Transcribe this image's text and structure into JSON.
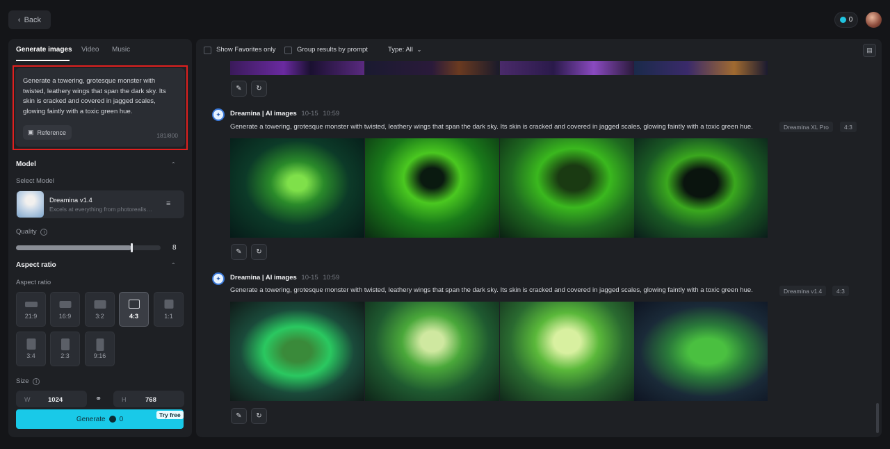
{
  "header": {
    "back_label": "Back",
    "credits": "0"
  },
  "left_panel": {
    "tabs": [
      "Generate images",
      "Video",
      "Music"
    ],
    "prompt": {
      "text": "Generate a towering, grotesque monster with twisted, leathery wings that span the dark sky. Its skin is cracked and covered in jagged scales, glowing faintly with a toxic green hue.",
      "reference_label": "Reference",
      "char_count": "181/800"
    },
    "model": {
      "section_title": "Model",
      "select_label": "Select Model",
      "name": "Dreamina v1.4",
      "description": "Excels at everything from photorealism to painterly styles",
      "quality_label": "Quality",
      "quality_value": "8",
      "quality_fraction": 0.8
    },
    "aspect": {
      "section_title": "Aspect ratio",
      "sub_label": "Aspect ratio",
      "options": [
        "21:9",
        "16:9",
        "3:2",
        "4:3",
        "1:1",
        "3:4",
        "2:3",
        "9:16"
      ],
      "selected": "4:3"
    },
    "size": {
      "label": "Size",
      "w_prefix": "W",
      "width": "1024",
      "h_prefix": "H",
      "height": "768"
    },
    "generate": {
      "label": "Generate",
      "cost": "0",
      "badge": "Try free"
    }
  },
  "main": {
    "filters": {
      "favorites": "Show Favorites only",
      "group": "Group results by prompt",
      "type": "Type: All"
    },
    "generations": [
      {
        "source": "Dreamina | AI images",
        "date": "10-15",
        "time": "10:59",
        "prompt": "Generate a towering, grotesque monster with twisted, leathery wings that span the dark sky. Its skin is cracked and covered in jagged scales, glowing faintly with a toxic green hue.",
        "model_tag": "Dreamina XL Pro",
        "ratio_tag": "4:3"
      },
      {
        "source": "Dreamina | AI images",
        "date": "10-15",
        "time": "10:59",
        "prompt": "Generate a towering, grotesque monster with twisted, leathery wings that span the dark sky. Its skin is cracked and covered in jagged scales, glowing faintly with a toxic green hue.",
        "model_tag": "Dreamina v1.4",
        "ratio_tag": "4:3"
      }
    ]
  },
  "colors": {
    "accent": "#19c9e8",
    "highlight": "#e0201f",
    "panel": "#1e2024",
    "background": "#141518"
  }
}
